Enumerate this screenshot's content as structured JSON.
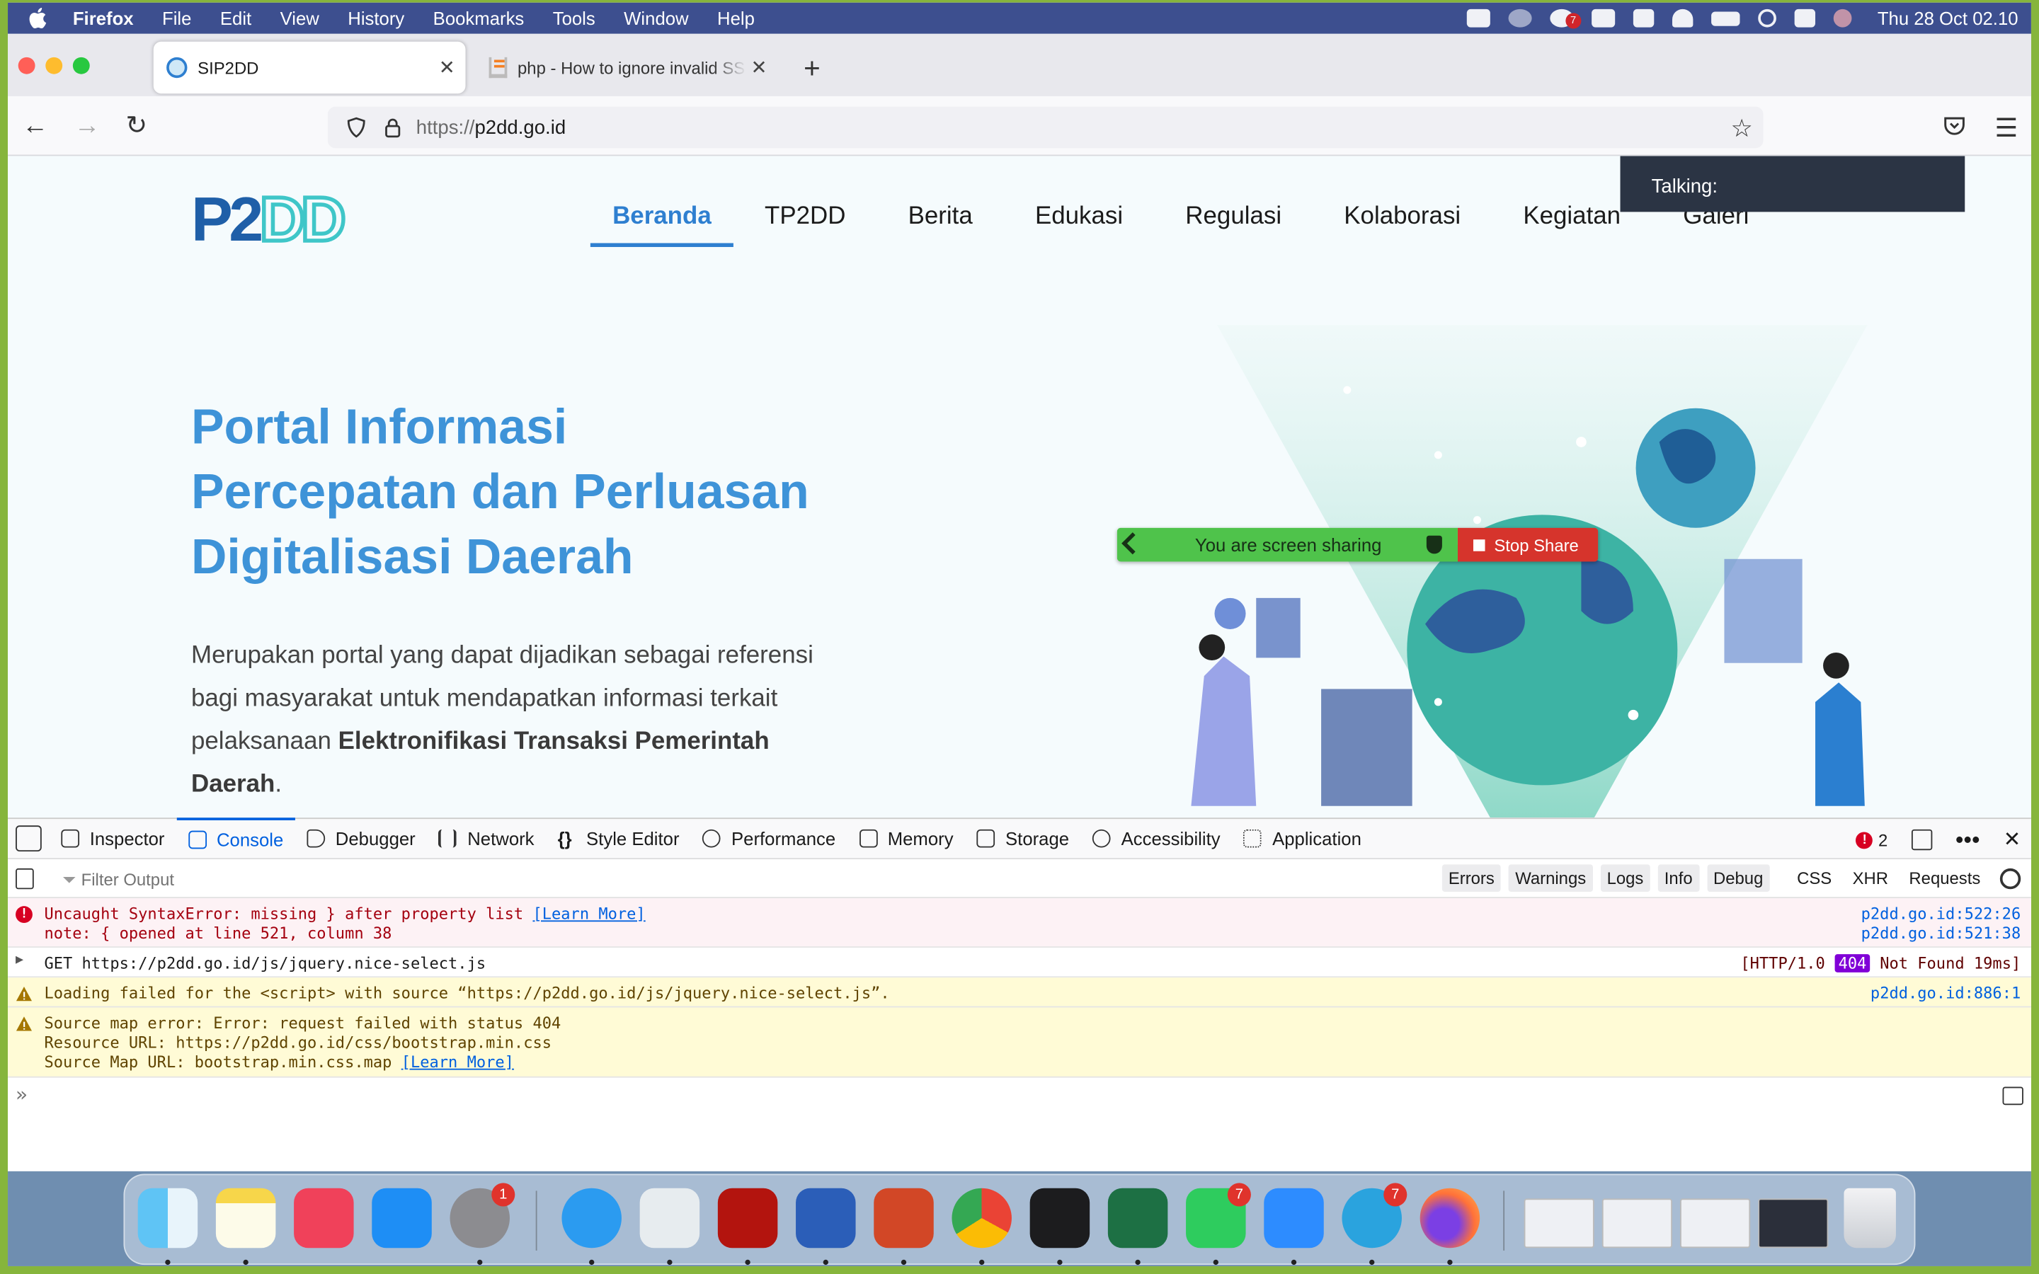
{
  "menubar": {
    "app_name": "Firefox",
    "items": [
      "File",
      "Edit",
      "View",
      "History",
      "Bookmarks",
      "Tools",
      "Window",
      "Help"
    ],
    "badge_count": "7",
    "clock": "Thu 28 Oct  02.10"
  },
  "tabs": [
    {
      "title": "SIP2DD",
      "active": true
    },
    {
      "title": "php - How to ignore invalid SSL",
      "active": false
    }
  ],
  "urlbar": {
    "scheme": "https://",
    "host": "p2dd.go.id"
  },
  "site": {
    "nav": [
      "Beranda",
      "TP2DD",
      "Berita",
      "Edukasi",
      "Regulasi",
      "Kolaborasi",
      "Kegiatan",
      "Galeri"
    ],
    "hero_title_lines": [
      "Portal Informasi",
      "Percepatan dan Perluasan",
      "Digitalisasi Daerah"
    ],
    "hero_desc_plain": "Merupakan portal yang dapat dijadikan sebagai referensi bagi masyarakat untuk mendapatkan informasi terkait pelaksanaan ",
    "hero_desc_bold": "Elektronifikasi Transaksi Pemerintah Daerah",
    "hero_desc_end": "."
  },
  "zoom": {
    "talking_label": "Talking:",
    "sharing_text": "You are screen sharing",
    "stop_share": "Stop Share"
  },
  "devtools": {
    "tabs": [
      "Inspector",
      "Console",
      "Debugger",
      "Network",
      "Style Editor",
      "Performance",
      "Memory",
      "Storage",
      "Accessibility",
      "Application"
    ],
    "active_tab": "Console",
    "error_count": "2",
    "filter_placeholder": "Filter Output",
    "filter_buttons": [
      "Errors",
      "Warnings",
      "Logs",
      "Info",
      "Debug"
    ],
    "type_buttons": [
      "CSS",
      "XHR",
      "Requests"
    ],
    "messages": [
      {
        "type": "error",
        "line1": "Uncaught SyntaxError: missing } after property list ",
        "learn": "[Learn More]",
        "line2": "note: { opened at line 521, column 38",
        "loc1": "p2dd.go.id:522:26",
        "loc2": "p2dd.go.id:521:38"
      },
      {
        "type": "network",
        "text": "GET https://p2dd.go.id/js/jquery.nice-select.js",
        "status_pre": "[HTTP/1.0 ",
        "status_code": "404",
        "status_post": " Not Found 19ms]"
      },
      {
        "type": "warning",
        "text": "Loading failed for the <script> with source “https://p2dd.go.id/js/jquery.nice-select.js”.",
        "loc": "p2dd.go.id:886:1"
      },
      {
        "type": "warning",
        "line1": "Source map error: Error: request failed with status 404",
        "line2": "Resource URL: https://p2dd.go.id/css/bootstrap.min.css",
        "line3": "Source Map URL: bootstrap.min.css.map ",
        "learn": "[Learn More]"
      }
    ],
    "prompt": "»"
  },
  "dock": {
    "badges": {
      "settings": "1",
      "whatsapp": "7",
      "telegram": "7"
    }
  },
  "colors": {
    "accent_blue": "#3e93d8",
    "devtools_blue": "#0060df",
    "error_red": "#d70022",
    "share_green": "#4fc34b",
    "share_red": "#d6342c"
  }
}
